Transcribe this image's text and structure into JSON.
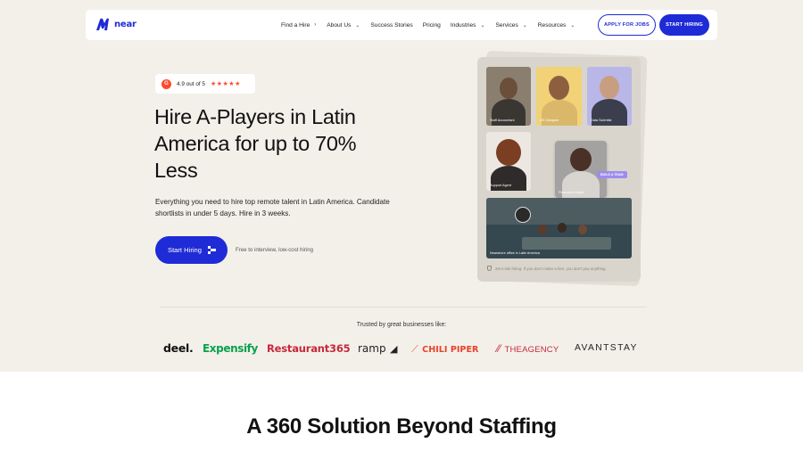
{
  "nav": {
    "logo_text": "near",
    "items": [
      {
        "label": "Find a Hire",
        "chevron": "›"
      },
      {
        "label": "About Us",
        "chevron": "⌄"
      },
      {
        "label": "Success Stories",
        "chevron": ""
      },
      {
        "label": "Pricing",
        "chevron": ""
      },
      {
        "label": "Industries",
        "chevron": "⌄"
      },
      {
        "label": "Services",
        "chevron": "⌄"
      },
      {
        "label": "Resources",
        "chevron": "⌄"
      }
    ],
    "apply_label": "APPLY FOR JOBS",
    "start_label": "START HIRING"
  },
  "hero": {
    "rating_badge": "G",
    "rating_text": "4.9 out of 5",
    "stars": "★★★★★",
    "title": "Hire A-Players in Latin America for up to 70% Less",
    "subtitle": "Everything you need to hire top remote talent in Latin America. Candidate shortlists in under 5 days. Hire in 3 weeks.",
    "cta_label": "Start Hiring",
    "cta_note": "Free to interview, low-cost hiring"
  },
  "card": {
    "tiles": [
      "Staff Accountant",
      "UX Designer",
      "Data Scientist",
      "Support Agent",
      "Financial Analyst",
      "Nearshore office in Latin America"
    ],
    "badge": "BUILD A TEAM",
    "footer": "Zero-risk hiring. If you don't make a hire, you don't pay anything."
  },
  "trusted": {
    "heading": "Trusted by great businesses like:",
    "logos": [
      "deel.",
      "Expensify",
      "Restaurant365",
      "ramp",
      "CHILI PIPER",
      "THEAGENCY",
      "AVANTSTAY"
    ]
  },
  "section2": {
    "title": "A 360 Solution Beyond Staffing"
  },
  "colors": {
    "brand_blue": "#1f2bd6",
    "background": "#f3f0ea",
    "g2_red": "#ff492c"
  }
}
